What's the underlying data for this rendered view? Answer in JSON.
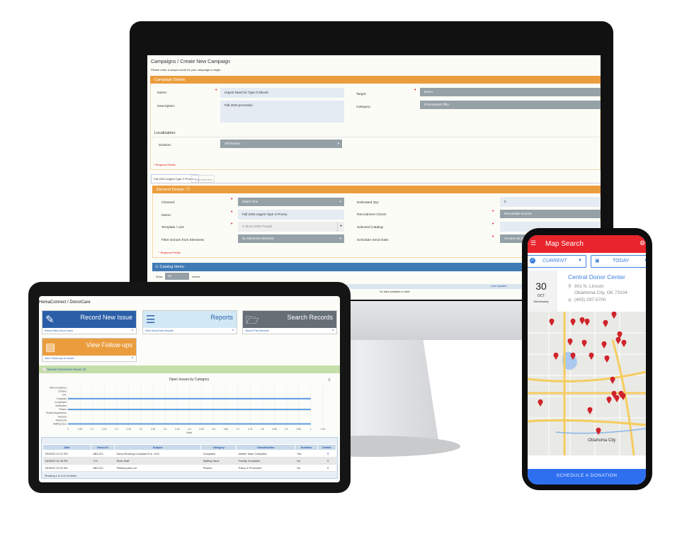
{
  "monitor": {
    "breadcrumb": "Campaigns / Create New Campaign",
    "subtitle": "Please enter a unique name for your campaign to begin.",
    "campaign_details": {
      "header": "Campaign Details",
      "name_label": "Name:",
      "name_value": "Urgent Need for Type O Blood!",
      "description_label": "Description:",
      "description_value": "Fall 2023 promotion",
      "target_label": "Target:",
      "target_value": "Donor",
      "category_label": "Category:",
      "category_value": "Promotional Offer",
      "localization_label": "Localization:",
      "division_label": "Division:",
      "division_value": "All Division",
      "required": "* Required Fields"
    },
    "tabs": [
      {
        "label": "Fall 2023 Urgent Type O Promo ×"
      },
      {
        "label": "+Add Element"
      }
    ],
    "element_details": {
      "header": "Element Details:",
      "channel_label": "Channel:",
      "channel_value": "Select One",
      "name_label": "Name:",
      "name_value": "Fall 2023 Urgent Type O Promo",
      "template_label": "Template / List:",
      "template_value": "O blood 2002 People",
      "template_add": "+",
      "filter_label": "Filter Donors from Elements:",
      "filter_value": "No Elements Selected",
      "qty_label": "Estimated Qty:",
      "qty_value": "0",
      "recruit_label": "Recruitment Check:",
      "recruit_value": "Recruitable Donors",
      "catalog_label": "Selected Catalog:",
      "catalog_value": "",
      "schedule_label": "Schedule Send Date:",
      "schedule_value": "As soon as possible",
      "required": "* Required Fields"
    },
    "catalog": {
      "header": "☷ Catalog Items:",
      "show": "Show",
      "entries_value": "10",
      "entries": "entries",
      "col_last_updated": "Last Updated",
      "empty": "No data available in table"
    }
  },
  "tablet": {
    "breadcrumb": "HemaConnect / DonorCare",
    "tiles": [
      {
        "title": "Record New Issue",
        "link": "Record New Donor Issue",
        "color": "#2a5fa8",
        "icon": "edit-document-icon"
      },
      {
        "title": "Reports",
        "link": "View DonorCare Reports",
        "color": "#d2e8f5",
        "icon": "list-icon"
      },
      {
        "title": "Search Records",
        "link": "Search Past Records",
        "color": "#666e76",
        "icon": "folder-open-icon"
      },
      {
        "title": "View Follow-ups",
        "link": "View Follow-ups to Issues",
        "color": "#eb9d3d",
        "icon": "document-icon"
      }
    ],
    "issues_bar": "Newest DonorCare Issues (3)",
    "table": {
      "columns": [
        "Date",
        "Donor ID",
        "Subject",
        "Category",
        "Classification",
        "Duration",
        "Details"
      ],
      "rows": [
        [
          "09/20/23 01:37 PM",
          "ABC123",
          "Donor Bruising Complaint R.A. 9/16",
          "Complaint",
          "Mobile Team Complaint",
          "Yes"
        ],
        [
          "06/26/23 01:48 PM",
          "174",
          "Rude Staff",
          "Staffing Issue",
          "Facility Complaint",
          "No"
        ],
        [
          "06/26/23 10:37 AM",
          "ABC123",
          "Plasma pass out",
          "Plasma",
          "Policy & Procedure",
          "No"
        ]
      ],
      "footer": "Showing 1 to 3 of 3 entries"
    }
  },
  "chart_data": {
    "type": "bar",
    "orientation": "horizontal",
    "title": "Open Issues by Category",
    "xlabel": "Visits",
    "ylabel": "",
    "categories": [
      "ADA Compliance",
      "Canteen",
      "CPL",
      "Complaint",
      "Compliment",
      "Notification",
      "Plasma",
      "Repairs/Appearance",
      "Request",
      "Restrooms",
      "Staffing Issue"
    ],
    "values": [
      0,
      0,
      0,
      1,
      0,
      0,
      1,
      0,
      0,
      0,
      1
    ],
    "xlim": [
      0,
      1.05
    ],
    "xticks": [
      "0",
      "0.05",
      "0.1",
      "0.15",
      "0.2",
      "0.25",
      "0.3",
      "0.35",
      "0.4",
      "0.45",
      "0.5",
      "0.55",
      "0.6",
      "0.65",
      "0.7",
      "0.75",
      "0.8",
      "0.85",
      "0.9",
      "0.95",
      "1",
      "1.05"
    ],
    "grid": true,
    "color": "#5b9be0"
  },
  "phone": {
    "title": "Map Search",
    "filter_location": "CURRENT",
    "filter_date": "TODAY",
    "day": "30",
    "month": "OCT",
    "weekday": "Wednesday",
    "center_name": "Central Donor Center",
    "address1": "901 N. Lincoln",
    "address2": "Oklahoma City, OK 73104",
    "phone": "(405) 297-5700",
    "map_city": "Oklahoma City",
    "cta": "SCHEDULE A DONATION",
    "accent": "#e8242c"
  }
}
